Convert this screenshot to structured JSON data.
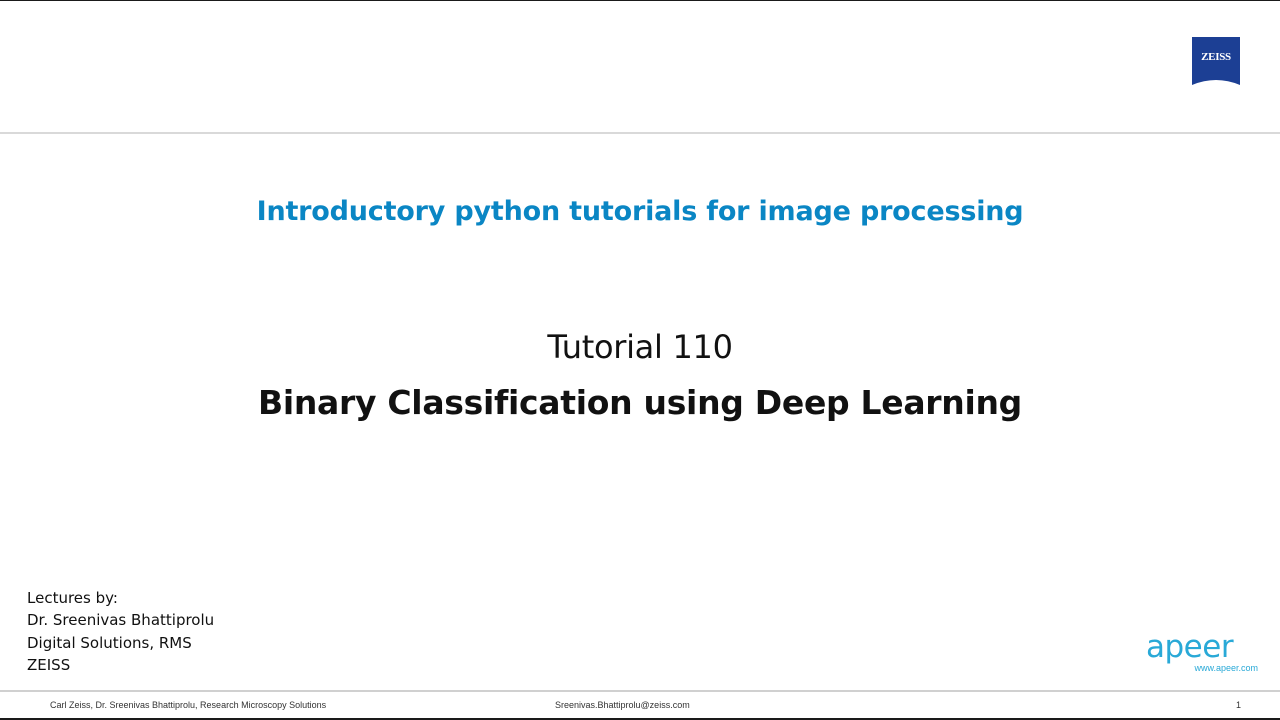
{
  "brand": {
    "logo_text": "ZEISS",
    "logo_color": "#1c3f94",
    "apeer_text": "apeer",
    "apeer_url": "www.apeer.com",
    "apeer_color": "#29a9d7"
  },
  "slide": {
    "subtitle": "Introductory python tutorials for image processing",
    "subtitle_color": "#0a86c4",
    "tutorial_number": "Tutorial 110",
    "title": "Binary Classification using Deep Learning"
  },
  "credits": {
    "lines": [
      "Lectures by:",
      "Dr. Sreenivas Bhattiprolu",
      "Digital Solutions, RMS",
      "ZEISS"
    ]
  },
  "footer": {
    "left": "Carl Zeiss, Dr. Sreenivas Bhattiprolu, Research Microscopy Solutions",
    "center": "Sreenivas.Bhattiprolu@zeiss.com",
    "page_number": "1"
  }
}
